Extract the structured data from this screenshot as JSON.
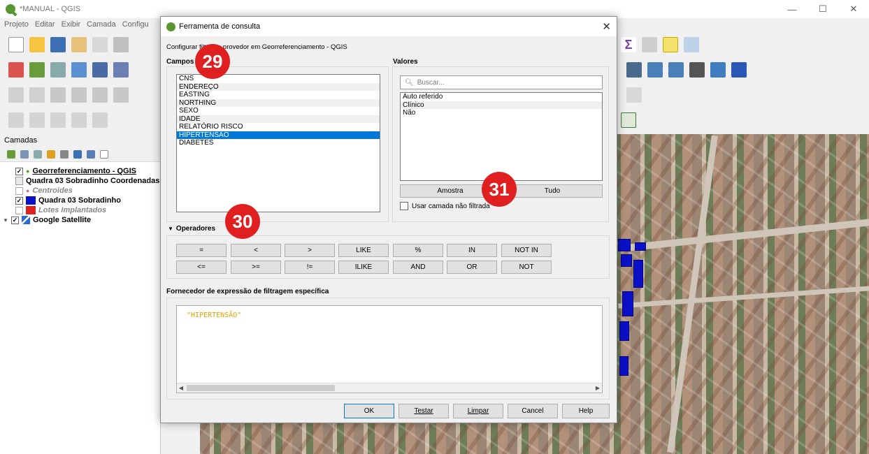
{
  "window": {
    "title": "*MANUAL - QGIS",
    "minimize": "—",
    "maximize": "☐",
    "close": "✕"
  },
  "menu": [
    "Projeto",
    "Editar",
    "Exibir",
    "Camada",
    "Configu"
  ],
  "layers_panel": {
    "title": "Camadas",
    "layers": [
      {
        "name": "Georreferenciamento - QGIS",
        "checked": "✓"
      },
      {
        "name": "Quadra 03 Sobradinho Coordenadas",
        "checked": ""
      },
      {
        "name": "Centroides",
        "checked": ""
      },
      {
        "name": "Quadra 03 Sobradinho",
        "checked": "✓"
      },
      {
        "name": "Lotes Implantados",
        "checked": ""
      },
      {
        "name": "Google Satellite",
        "checked": "✓"
      }
    ]
  },
  "dialog": {
    "title": "Ferramenta de consulta",
    "close": "✕",
    "subtitle": "Configurar filtro do provedor em Georreferenciamento - QGIS",
    "fields_label": "Campos",
    "fields": [
      "CNS",
      "ENDEREÇO",
      "EASTING",
      "NORTHING",
      "SEXO",
      "IDADE",
      "RELATÓRIO RISCO",
      "HIPERTENSÃO",
      "DIABETES"
    ],
    "selected_field": "HIPERTENSÃO",
    "values_label": "Valores",
    "search_placeholder": "Buscar...",
    "values": [
      "Auto referido",
      "Clínico",
      "Não"
    ],
    "sample_button": "Amostra",
    "all_button": "Tudo",
    "unfiltered_checkbox": "Usar camada não filtrada",
    "operators_label": "Operadores",
    "operators_row1": [
      "=",
      "<",
      ">",
      "LIKE",
      "%",
      "IN",
      "NOT IN"
    ],
    "operators_row2": [
      "<=",
      ">=",
      "!=",
      "ILIKE",
      "AND",
      "OR",
      "NOT"
    ],
    "expression_label": "Fornecedor de expressão de filtragem específica",
    "expression": "\"HIPERTENSÃO\"",
    "buttons": {
      "ok": "OK",
      "test": "Testar",
      "clear": "Limpar",
      "cancel": "Cancel",
      "help": "Help"
    }
  },
  "annotations": [
    "29",
    "30",
    "31"
  ]
}
